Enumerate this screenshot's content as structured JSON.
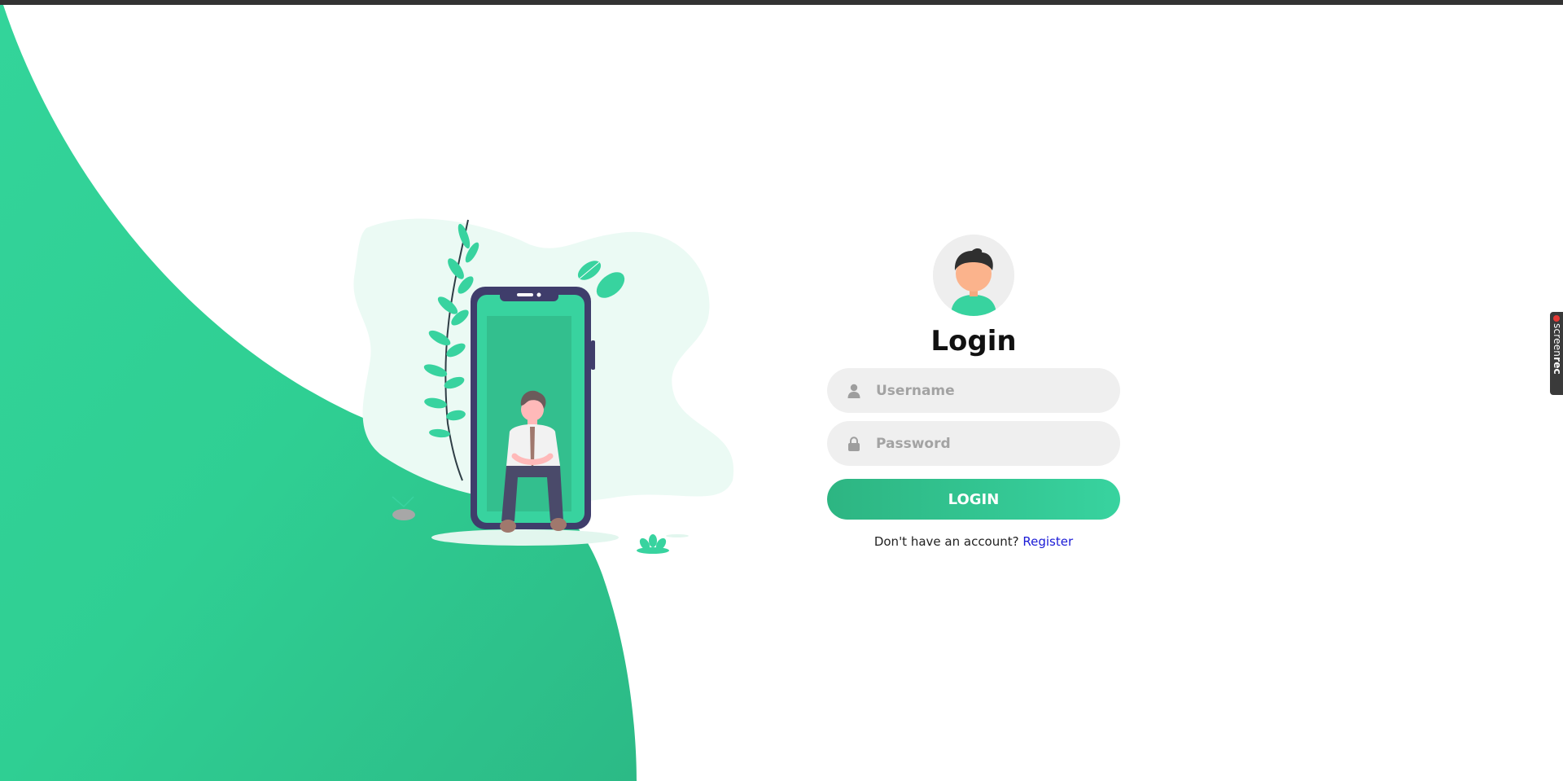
{
  "colors": {
    "accent": "#38d39f",
    "accent_dark": "#2db582",
    "link": "#1a1ad6",
    "field_bg": "#efefef",
    "top_bar": "#333333"
  },
  "illustration": {
    "name": "man-sitting-on-phone-illustration"
  },
  "login": {
    "avatar_icon": "user-avatar-icon",
    "title": "Login",
    "username": {
      "icon": "user-icon",
      "placeholder": "Username",
      "value": ""
    },
    "password": {
      "icon": "lock-icon",
      "placeholder": "Password",
      "value": ""
    },
    "button_label": "LOGIN",
    "register_prompt": "Don't have an account?",
    "register_link": "Register"
  },
  "screenrec": {
    "text_light": "screen",
    "text_bold": "rec"
  }
}
